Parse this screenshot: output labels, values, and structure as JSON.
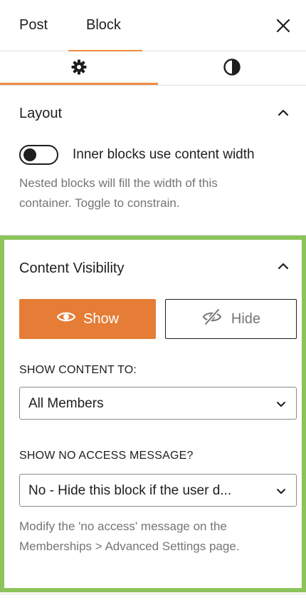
{
  "tabs": {
    "post": "Post",
    "block": "Block"
  },
  "icons": {
    "close": "close-icon",
    "settings": "gear-icon",
    "styles": "contrast-icon"
  },
  "layout": {
    "title": "Layout",
    "toggle_label": "Inner blocks use content width",
    "toggle_on": false,
    "help_line1": "Nested blocks will fill the width of this",
    "help_line2": "container. Toggle to constrain."
  },
  "visibility": {
    "title": "Content Visibility",
    "show_label": "Show",
    "hide_label": "Hide",
    "show_to_label": "SHOW CONTENT TO:",
    "show_to_value": "All Members",
    "no_access_label": "SHOW NO ACCESS MESSAGE?",
    "no_access_value": "No - Hide this block if the user d...",
    "help_line1": "Modify the 'no access' message on the",
    "help_line2": "Memberships > Advanced Settings page."
  },
  "colors": {
    "accent": "#e57d36",
    "highlight_border": "#8cc35a",
    "help_text": "#757575"
  }
}
